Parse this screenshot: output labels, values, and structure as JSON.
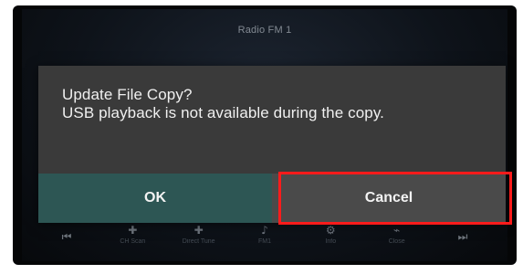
{
  "screen": {
    "top_indicator": "",
    "title": "Radio FM 1",
    "status_left": "",
    "status_right": "",
    "side_hint_right": "▲"
  },
  "background_controls": [
    {
      "glyph": "⏮",
      "label": ""
    },
    {
      "glyph": "✚",
      "label": "CH Scan"
    },
    {
      "glyph": "✚",
      "label": "Direct Tune"
    },
    {
      "glyph": "♪",
      "label": "FM1"
    },
    {
      "glyph": "⚙",
      "label": "Info"
    },
    {
      "glyph": "⌁",
      "label": "Close"
    },
    {
      "glyph": "⏭",
      "label": ""
    }
  ],
  "dialog": {
    "title": "Update File Copy?",
    "message": "USB playback is not available during the copy.",
    "buttons": {
      "ok": "OK",
      "cancel": "Cancel"
    },
    "highlight_color": "#ff1b1b"
  }
}
